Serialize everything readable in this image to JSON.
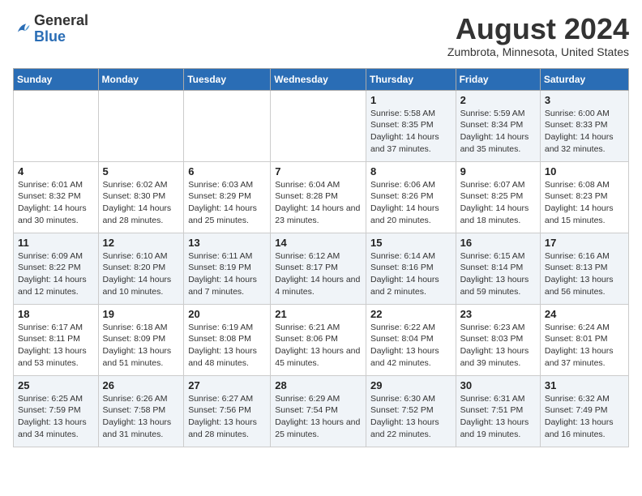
{
  "logo": {
    "general": "General",
    "blue": "Blue"
  },
  "title": {
    "month_year": "August 2024",
    "location": "Zumbrota, Minnesota, United States"
  },
  "days_of_week": [
    "Sunday",
    "Monday",
    "Tuesday",
    "Wednesday",
    "Thursday",
    "Friday",
    "Saturday"
  ],
  "weeks": [
    [
      {
        "day": "",
        "info": ""
      },
      {
        "day": "",
        "info": ""
      },
      {
        "day": "",
        "info": ""
      },
      {
        "day": "",
        "info": ""
      },
      {
        "day": "1",
        "info": "Sunrise: 5:58 AM\nSunset: 8:35 PM\nDaylight: 14 hours and 37 minutes."
      },
      {
        "day": "2",
        "info": "Sunrise: 5:59 AM\nSunset: 8:34 PM\nDaylight: 14 hours and 35 minutes."
      },
      {
        "day": "3",
        "info": "Sunrise: 6:00 AM\nSunset: 8:33 PM\nDaylight: 14 hours and 32 minutes."
      }
    ],
    [
      {
        "day": "4",
        "info": "Sunrise: 6:01 AM\nSunset: 8:32 PM\nDaylight: 14 hours and 30 minutes."
      },
      {
        "day": "5",
        "info": "Sunrise: 6:02 AM\nSunset: 8:30 PM\nDaylight: 14 hours and 28 minutes."
      },
      {
        "day": "6",
        "info": "Sunrise: 6:03 AM\nSunset: 8:29 PM\nDaylight: 14 hours and 25 minutes."
      },
      {
        "day": "7",
        "info": "Sunrise: 6:04 AM\nSunset: 8:28 PM\nDaylight: 14 hours and 23 minutes."
      },
      {
        "day": "8",
        "info": "Sunrise: 6:06 AM\nSunset: 8:26 PM\nDaylight: 14 hours and 20 minutes."
      },
      {
        "day": "9",
        "info": "Sunrise: 6:07 AM\nSunset: 8:25 PM\nDaylight: 14 hours and 18 minutes."
      },
      {
        "day": "10",
        "info": "Sunrise: 6:08 AM\nSunset: 8:23 PM\nDaylight: 14 hours and 15 minutes."
      }
    ],
    [
      {
        "day": "11",
        "info": "Sunrise: 6:09 AM\nSunset: 8:22 PM\nDaylight: 14 hours and 12 minutes."
      },
      {
        "day": "12",
        "info": "Sunrise: 6:10 AM\nSunset: 8:20 PM\nDaylight: 14 hours and 10 minutes."
      },
      {
        "day": "13",
        "info": "Sunrise: 6:11 AM\nSunset: 8:19 PM\nDaylight: 14 hours and 7 minutes."
      },
      {
        "day": "14",
        "info": "Sunrise: 6:12 AM\nSunset: 8:17 PM\nDaylight: 14 hours and 4 minutes."
      },
      {
        "day": "15",
        "info": "Sunrise: 6:14 AM\nSunset: 8:16 PM\nDaylight: 14 hours and 2 minutes."
      },
      {
        "day": "16",
        "info": "Sunrise: 6:15 AM\nSunset: 8:14 PM\nDaylight: 13 hours and 59 minutes."
      },
      {
        "day": "17",
        "info": "Sunrise: 6:16 AM\nSunset: 8:13 PM\nDaylight: 13 hours and 56 minutes."
      }
    ],
    [
      {
        "day": "18",
        "info": "Sunrise: 6:17 AM\nSunset: 8:11 PM\nDaylight: 13 hours and 53 minutes."
      },
      {
        "day": "19",
        "info": "Sunrise: 6:18 AM\nSunset: 8:09 PM\nDaylight: 13 hours and 51 minutes."
      },
      {
        "day": "20",
        "info": "Sunrise: 6:19 AM\nSunset: 8:08 PM\nDaylight: 13 hours and 48 minutes."
      },
      {
        "day": "21",
        "info": "Sunrise: 6:21 AM\nSunset: 8:06 PM\nDaylight: 13 hours and 45 minutes."
      },
      {
        "day": "22",
        "info": "Sunrise: 6:22 AM\nSunset: 8:04 PM\nDaylight: 13 hours and 42 minutes."
      },
      {
        "day": "23",
        "info": "Sunrise: 6:23 AM\nSunset: 8:03 PM\nDaylight: 13 hours and 39 minutes."
      },
      {
        "day": "24",
        "info": "Sunrise: 6:24 AM\nSunset: 8:01 PM\nDaylight: 13 hours and 37 minutes."
      }
    ],
    [
      {
        "day": "25",
        "info": "Sunrise: 6:25 AM\nSunset: 7:59 PM\nDaylight: 13 hours and 34 minutes."
      },
      {
        "day": "26",
        "info": "Sunrise: 6:26 AM\nSunset: 7:58 PM\nDaylight: 13 hours and 31 minutes."
      },
      {
        "day": "27",
        "info": "Sunrise: 6:27 AM\nSunset: 7:56 PM\nDaylight: 13 hours and 28 minutes."
      },
      {
        "day": "28",
        "info": "Sunrise: 6:29 AM\nSunset: 7:54 PM\nDaylight: 13 hours and 25 minutes."
      },
      {
        "day": "29",
        "info": "Sunrise: 6:30 AM\nSunset: 7:52 PM\nDaylight: 13 hours and 22 minutes."
      },
      {
        "day": "30",
        "info": "Sunrise: 6:31 AM\nSunset: 7:51 PM\nDaylight: 13 hours and 19 minutes."
      },
      {
        "day": "31",
        "info": "Sunrise: 6:32 AM\nSunset: 7:49 PM\nDaylight: 13 hours and 16 minutes."
      }
    ]
  ]
}
